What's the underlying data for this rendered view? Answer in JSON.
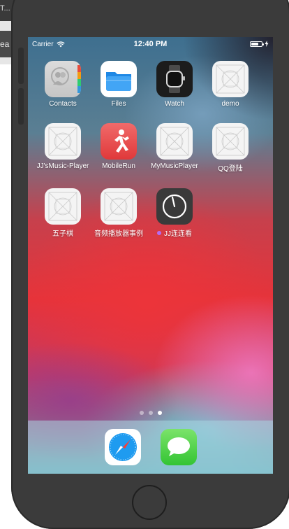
{
  "host": {
    "label_top": "T...",
    "label_mid": "ea"
  },
  "status_bar": {
    "carrier": "Carrier",
    "time": "12:40 PM",
    "charging_icon": "bolt-icon"
  },
  "apps": [
    {
      "label": "Contacts",
      "icon": "contacts-icon"
    },
    {
      "label": "Files",
      "icon": "files-icon"
    },
    {
      "label": "Watch",
      "icon": "watch-icon"
    },
    {
      "label": "demo",
      "icon": "placeholder-app-icon"
    },
    {
      "label": "JJ'sMusic-Player",
      "icon": "placeholder-app-icon"
    },
    {
      "label": "MobileRun",
      "icon": "running-person-icon"
    },
    {
      "label": "MyMusicPlayer",
      "icon": "placeholder-app-icon"
    },
    {
      "label": "QQ登陆",
      "icon": "placeholder-app-icon"
    },
    {
      "label": "五子棋",
      "icon": "placeholder-app-icon"
    },
    {
      "label": "音频播放器事例",
      "icon": "placeholder-app-icon"
    },
    {
      "label": "JJ连连看",
      "icon": "timer-icon",
      "new_dot": true
    }
  ],
  "page_indicator": {
    "pages": 3,
    "current": 3
  },
  "dock": [
    {
      "name": "Safari",
      "icon": "safari-compass-icon"
    },
    {
      "name": "Messages",
      "icon": "messages-bubble-icon"
    }
  ]
}
